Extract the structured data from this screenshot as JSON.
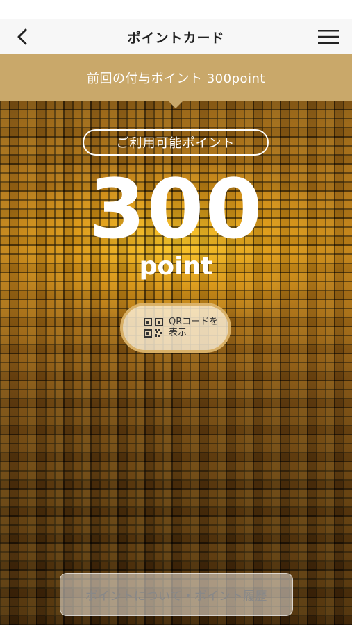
{
  "header": {
    "title": "ポイントカード",
    "back_icon": "chevron-left-icon",
    "menu_icon": "hamburger-menu-icon"
  },
  "banner": {
    "text": "前回の付与ポイント 300point",
    "color": "#c9a86a"
  },
  "points": {
    "label": "ご利用可能ポイント",
    "value": "300",
    "unit": "point"
  },
  "qr_button": {
    "icon": "qr-code-icon",
    "label": "QRコードを表示"
  },
  "footer": {
    "link_label": "ポイントについて・ポイント履歴"
  }
}
